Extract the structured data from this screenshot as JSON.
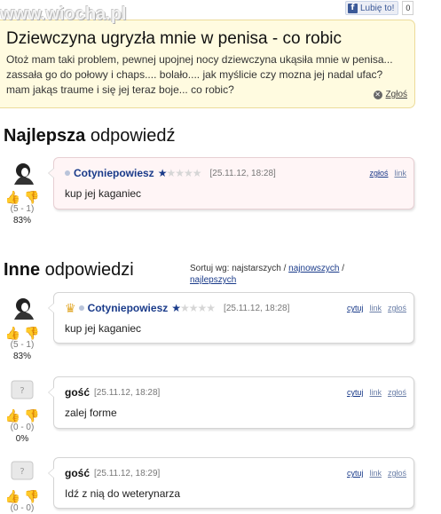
{
  "watermark": "www.wiocha.pl",
  "like": {
    "label": "Lubię to!",
    "count": "0"
  },
  "question": {
    "title": "Dziewczyna ugryzła mnie w penisa - co robic",
    "body": "Otoż mam taki problem, pewnej upojnej nocy dziewczyna ukąsiła mnie w penisa... zassała go do połowy i chaps.... bolało.... jak myślicie czy mozna jej nadal ufac? mam jakąs traume i się jej teraz boje... co robic?",
    "report": "Zgłoś"
  },
  "best": {
    "heading_bold": "Najlepsza",
    "heading_rest": " odpowiedź",
    "answer": {
      "user": "Cotyniepowiesz",
      "date": "[25.11.12, 18:28]",
      "text": "kup jej kaganiec",
      "votes": "(5 - 1)",
      "percent": "83%",
      "actions": [
        "zgłoś",
        "link"
      ]
    }
  },
  "others": {
    "heading_bold": "Inne",
    "heading_rest": " odpowiedzi",
    "sort_label": "Sortuj wg: najstarszych / ",
    "sort_newest": "najnowszych",
    "sort_sep": " /",
    "sort_best": "najlepszych",
    "answers": [
      {
        "user": "Cotyniepowiesz",
        "date": "[25.11.12, 18:28]",
        "text": "kup jej kaganiec",
        "votes": "(5 - 1)",
        "percent": "83%",
        "actions": [
          "cytuj",
          "link",
          "zgłoś"
        ]
      },
      {
        "user": "gość",
        "date": "[25.11.12, 18:28]",
        "text": "zalej forme",
        "votes": "(0 - 0)",
        "percent": "0%",
        "actions": [
          "cytuj",
          "link",
          "zgłoś"
        ]
      },
      {
        "user": "gość",
        "date": "[25.11.12, 18:29]",
        "text": "Idź z nią do weterynarza",
        "votes": "(0 - 0)",
        "percent": "",
        "actions": [
          "cytuj",
          "link",
          "zgłoś"
        ]
      }
    ]
  },
  "colors": {
    "link": "#1a3b8a",
    "question_bg": "#fffbe0",
    "best_bg": "#fff5f6"
  }
}
